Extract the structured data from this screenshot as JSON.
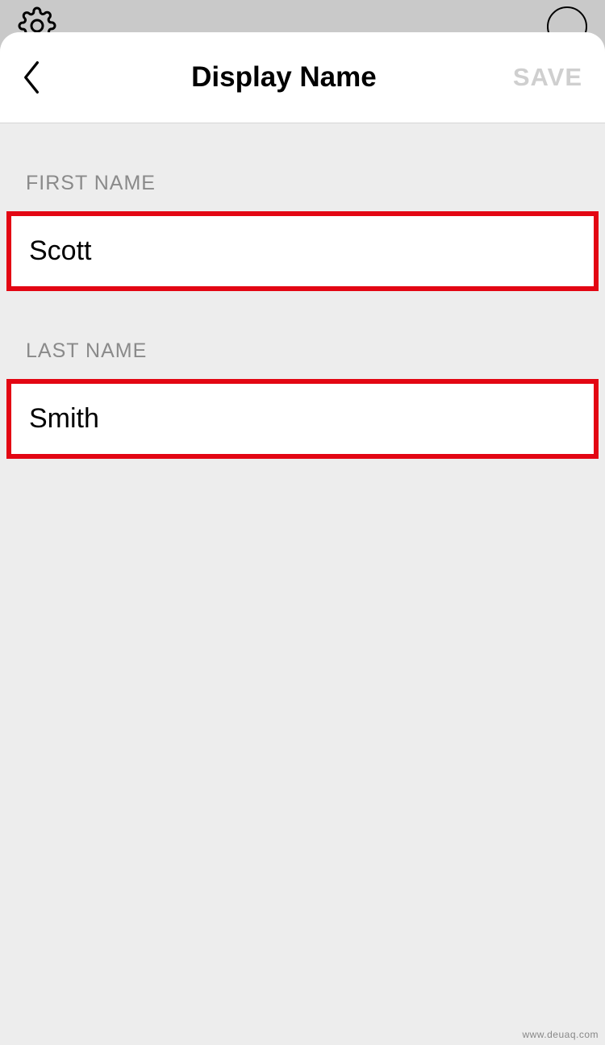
{
  "header": {
    "title": "Display Name",
    "save_label": "SAVE"
  },
  "form": {
    "first_name": {
      "label": "FIRST NAME",
      "value": "Scott"
    },
    "last_name": {
      "label": "LAST NAME",
      "value": "Smith"
    }
  },
  "watermark": "www.deuaq.com"
}
